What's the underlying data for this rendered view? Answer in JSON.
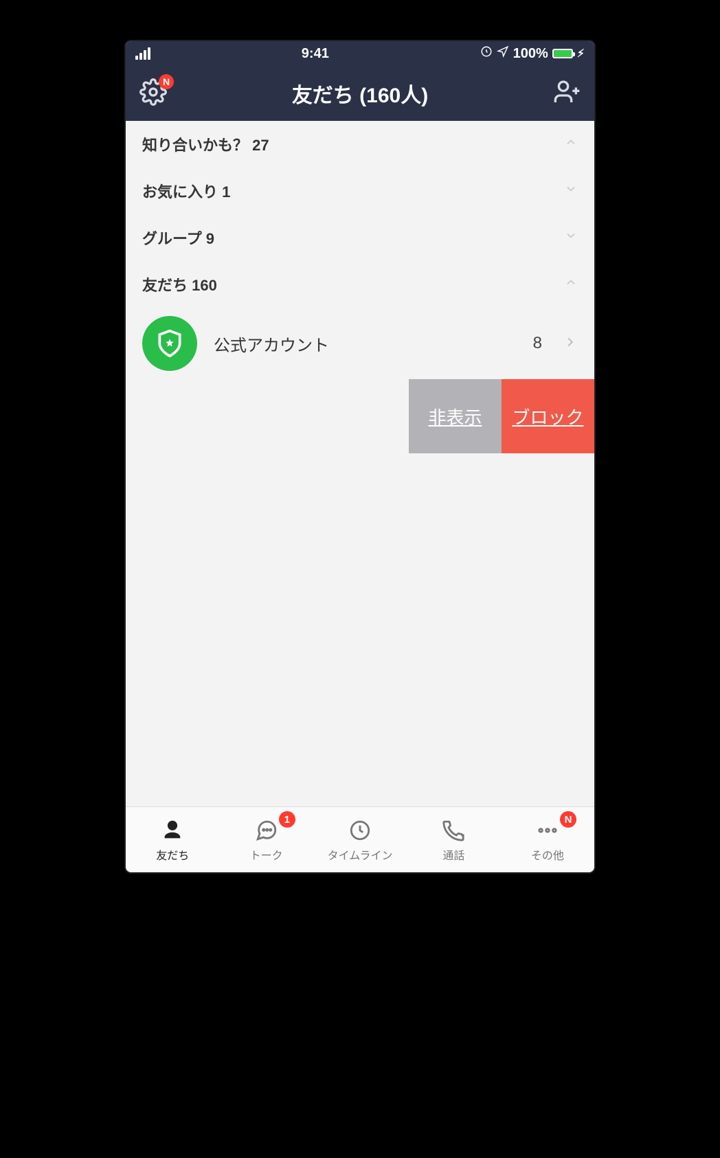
{
  "status": {
    "time": "9:41",
    "battery_pct": "100%"
  },
  "header": {
    "title": "友だち (160人)",
    "settings_badge": "N"
  },
  "sections": {
    "suggestions": {
      "label": "知り合いかも？ 27"
    },
    "favorites": {
      "label": "お気に入り 1"
    },
    "groups": {
      "label": "グループ 9"
    },
    "friends": {
      "label": "友だち 160"
    }
  },
  "official": {
    "label": "公式アカウント",
    "count": "8"
  },
  "swipe": {
    "hide": "非表示",
    "block": "ブロック"
  },
  "tabs": {
    "friends": {
      "label": "友だち"
    },
    "talk": {
      "label": "トーク",
      "badge": "1"
    },
    "timeline": {
      "label": "タイムライン"
    },
    "call": {
      "label": "通話"
    },
    "more": {
      "label": "その他",
      "badge": "N"
    }
  }
}
